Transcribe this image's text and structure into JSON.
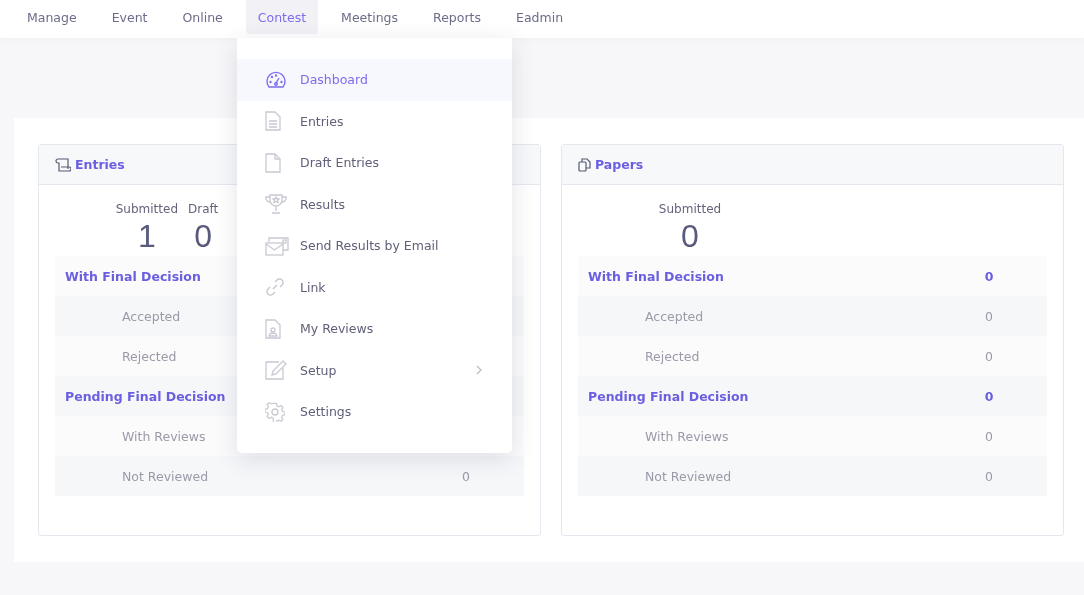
{
  "nav": [
    {
      "label": "Manage",
      "selected": false
    },
    {
      "label": "Event",
      "selected": false
    },
    {
      "label": "Online",
      "selected": false
    },
    {
      "label": "Contest",
      "selected": true
    },
    {
      "label": "Meetings",
      "selected": false
    },
    {
      "label": "Reports",
      "selected": false
    },
    {
      "label": "Eadmin",
      "selected": false
    }
  ],
  "cards": [
    {
      "title": "Entries",
      "stats": [
        {
          "label": "Submitted",
          "value": "1"
        },
        {
          "label": "Draft",
          "value": "0"
        }
      ],
      "rows": [
        {
          "kind": "group",
          "label": "With Final Decision"
        },
        {
          "kind": "item",
          "label": "Accepted"
        },
        {
          "kind": "item",
          "label": "Rejected"
        },
        {
          "kind": "group",
          "label": "Pending Final Decision"
        },
        {
          "kind": "item",
          "label": "With Reviews"
        },
        {
          "kind": "item",
          "label": "Not Reviewed",
          "value": "0"
        }
      ]
    },
    {
      "title": "Papers",
      "stats": [
        {
          "label": "Submitted",
          "value": "0"
        }
      ],
      "rows": [
        {
          "kind": "group",
          "label": "With Final Decision",
          "value": "0"
        },
        {
          "kind": "item",
          "label": "Accepted",
          "value": "0"
        },
        {
          "kind": "item",
          "label": "Rejected",
          "value": "0"
        },
        {
          "kind": "group",
          "label": "Pending Final Decision",
          "value": "0"
        },
        {
          "kind": "item",
          "label": "With Reviews",
          "value": "0"
        },
        {
          "kind": "item",
          "label": "Not Reviewed",
          "value": "0"
        }
      ]
    }
  ],
  "menu": [
    {
      "label": "Dashboard",
      "selected": true,
      "submenu": false
    },
    {
      "label": "Entries",
      "selected": false,
      "submenu": false
    },
    {
      "label": "Draft Entries",
      "selected": false,
      "submenu": false
    },
    {
      "label": "Results",
      "selected": false,
      "submenu": false
    },
    {
      "label": "Send Results by Email",
      "selected": false,
      "submenu": false
    },
    {
      "label": "Link",
      "selected": false,
      "submenu": false
    },
    {
      "label": "My Reviews",
      "selected": false,
      "submenu": false
    },
    {
      "label": "Setup",
      "selected": false,
      "submenu": true
    },
    {
      "label": "Settings",
      "selected": false,
      "submenu": false
    }
  ]
}
